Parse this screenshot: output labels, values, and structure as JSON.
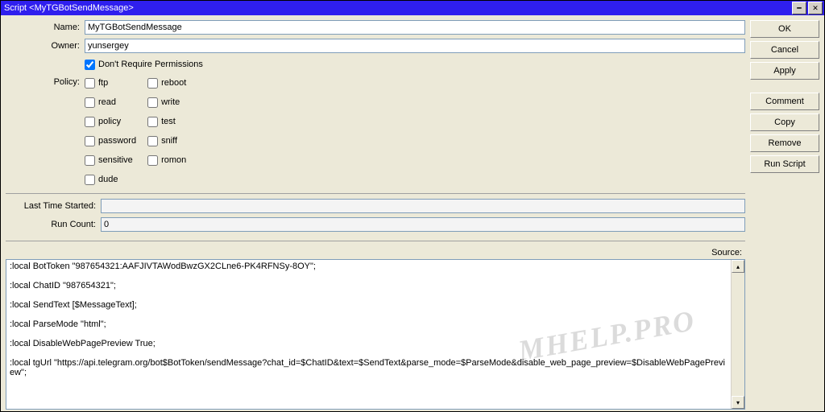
{
  "title": "Script <MyTGBotSendMessage>",
  "buttons": {
    "ok": "OK",
    "cancel": "Cancel",
    "apply": "Apply",
    "comment": "Comment",
    "copy": "Copy",
    "remove": "Remove",
    "run": "Run Script"
  },
  "labels": {
    "name": "Name:",
    "owner": "Owner:",
    "policy": "Policy:",
    "lastStart": "Last Time Started:",
    "runCount": "Run Count:",
    "source": "Source:"
  },
  "fields": {
    "name": "MyTGBotSendMessage",
    "owner": "yunsergey",
    "lastStart": "",
    "runCount": "0"
  },
  "dontRequire": {
    "label": "Don't Require Permissions",
    "checked": true
  },
  "policy": {
    "col1": [
      {
        "k": "ftp",
        "v": false
      },
      {
        "k": "read",
        "v": false
      },
      {
        "k": "policy",
        "v": false
      },
      {
        "k": "password",
        "v": false
      },
      {
        "k": "sensitive",
        "v": false
      },
      {
        "k": "dude",
        "v": false
      }
    ],
    "col2": [
      {
        "k": "reboot",
        "v": false
      },
      {
        "k": "write",
        "v": false
      },
      {
        "k": "test",
        "v": false
      },
      {
        "k": "sniff",
        "v": false
      },
      {
        "k": "romon",
        "v": false
      }
    ]
  },
  "source": ":local BotToken \"987654321:AAFJIVTAWodBwzGX2CLne6-PK4RFNSy-8OY\";\n\n:local ChatID \"987654321\";\n\n:local SendText [$MessageText];\n\n:local ParseMode \"html\";\n\n:local DisableWebPagePreview True;\n\n:local tgUrl \"https://api.telegram.org/bot$BotToken/sendMessage?chat_id=$ChatID&text=$SendText&parse_mode=$ParseMode&disable_web_page_preview=$DisableWebPagePreview\";",
  "watermark": "MHELP.PRO"
}
